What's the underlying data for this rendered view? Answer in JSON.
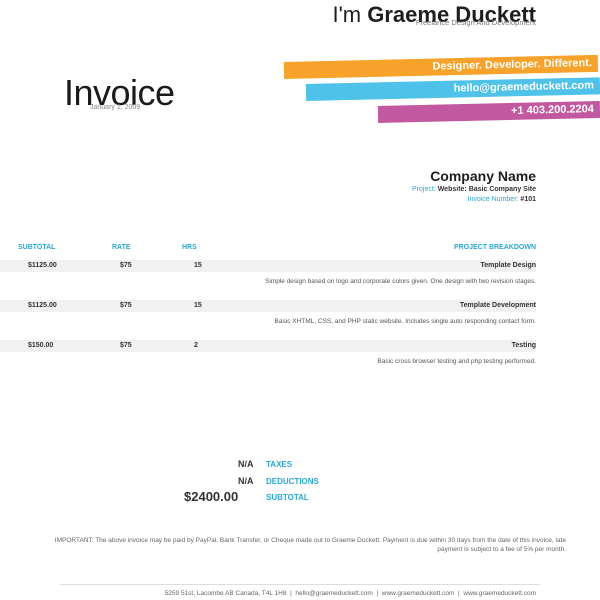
{
  "header": {
    "intro": "I'm",
    "name": "Graeme Duckett",
    "subtitle": "Freelance Design And Development"
  },
  "invoice": {
    "title": "Invoice",
    "date": "January 1, 2009"
  },
  "stripes": {
    "tagline": "Designer. Developer. Different.",
    "email": "hello@graemeduckett.com",
    "phone": "+1 403.200.2204"
  },
  "client": {
    "company": "Company Name",
    "project_label": "Project:",
    "project_value": "Website: Basic Company Site",
    "invoice_label": "Invoice Number:",
    "invoice_value": "#101"
  },
  "table": {
    "headers": {
      "breakdown": "PROJECT BREAKDOWN",
      "hrs": "HRS",
      "rate": "RATE",
      "subtotal": "SUBTOTAL"
    },
    "rows": [
      {
        "item": "Template Design",
        "hrs": "15",
        "rate": "$75",
        "subtotal": "$1125.00",
        "description": "Simple design based on logo and corporate colors given. One design with two revision stages."
      },
      {
        "item": "Template Development",
        "hrs": "15",
        "rate": "$75",
        "subtotal": "$1125.00",
        "description": "Basic XHTML, CSS, and PHP static website. Includes single auto responding contact form."
      },
      {
        "item": "Testing",
        "hrs": "2",
        "rate": "$75",
        "subtotal": "$150.00",
        "description": "Basic cross browser testing and php testing performed."
      }
    ]
  },
  "summary": {
    "taxes_label": "TAXES",
    "taxes_value": "N/A",
    "deductions_label": "DEDUCTIONS",
    "deductions_value": "N/A",
    "subtotal_label": "SUBTOTAL",
    "subtotal_value": "$2400.00"
  },
  "note": "IMPORTANT: The above invoice may be paid by PayPal, Bank Transfer, or Cheque made out to Graeme Duckett. Payment is due within 30 days from the date of this invoice, late payment is subject to a fee of 5% per month.",
  "footer": {
    "address": "5259 51st, Lacombe AB Canada, T4L 1H8",
    "email": "hello@graemeduckett.com",
    "site": "www.graemeduckett.com",
    "site2": "www.graemeduckett.com",
    "separator": "|"
  },
  "colors": {
    "orange": "#f7a22a",
    "blue": "#4ec2e8",
    "pink": "#c2589f",
    "accent": "#29a8d8"
  }
}
